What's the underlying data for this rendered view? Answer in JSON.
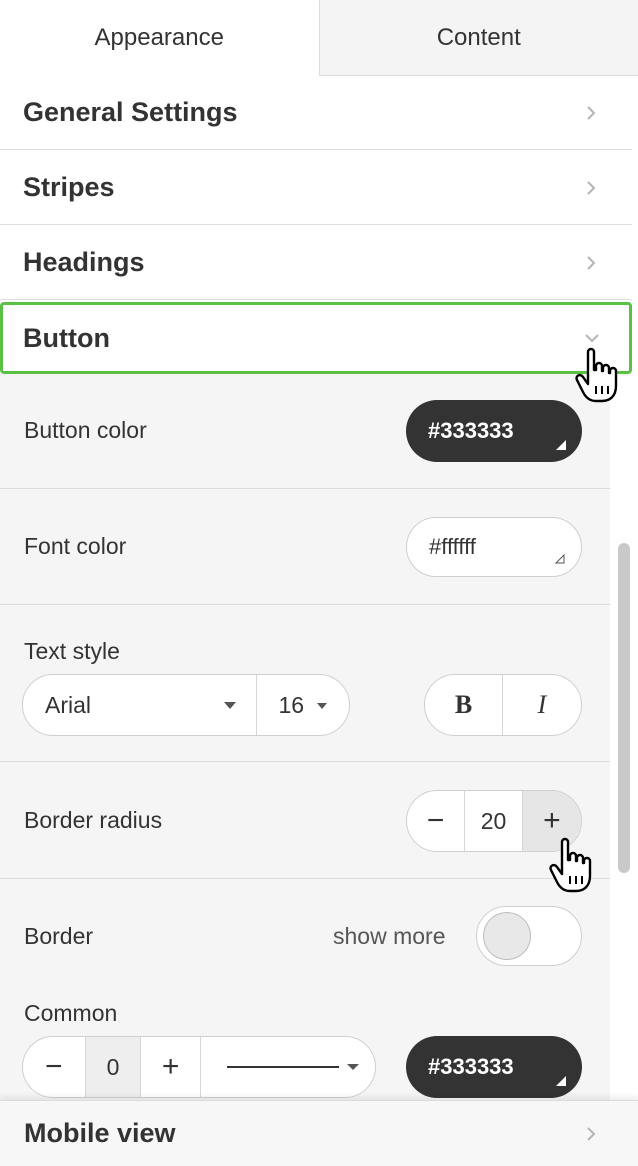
{
  "tabs": {
    "appearance": "Appearance",
    "content": "Content"
  },
  "sections": {
    "general": "General Settings",
    "stripes": "Stripes",
    "headings": "Headings",
    "button": "Button",
    "mobile": "Mobile view"
  },
  "button_panel": {
    "button_color": {
      "label": "Button color",
      "value": "#333333"
    },
    "font_color": {
      "label": "Font color",
      "value": "#ffffff"
    },
    "text_style": {
      "label": "Text style",
      "font": "Arial",
      "size": "16",
      "bold": "B",
      "italic": "I"
    },
    "border_radius": {
      "label": "Border radius",
      "minus": "−",
      "value": "20",
      "plus": "+"
    },
    "border": {
      "label": "Border",
      "show_more": "show more",
      "common_label": "Common",
      "minus": "−",
      "width": "0",
      "plus": "+",
      "color": "#333333"
    }
  },
  "colors": {
    "accent": "#5ac145",
    "dark": "#333333"
  }
}
